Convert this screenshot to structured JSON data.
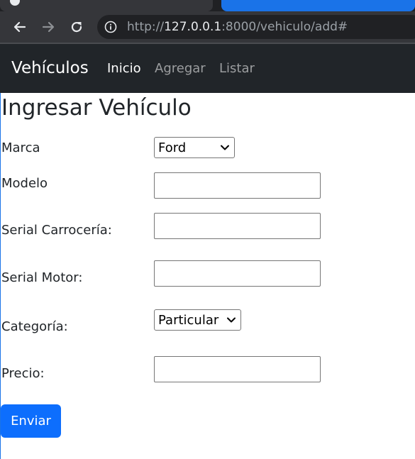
{
  "browser": {
    "url_scheme": "http://",
    "url_host": "127.0.0.1",
    "url_rest": ":8000/vehiculo/add#",
    "colors": {
      "frame": "#202124",
      "toolbar": "#35363a",
      "tab_accent": "#1a73e8"
    },
    "icons": [
      "back-arrow-icon",
      "forward-arrow-icon",
      "reload-icon",
      "info-icon"
    ]
  },
  "navbar": {
    "brand": "Vehículos",
    "links": [
      {
        "label": "Inicio",
        "active": true
      },
      {
        "label": "Agregar",
        "active": false
      },
      {
        "label": "Listar",
        "active": false
      }
    ],
    "color": "#212529"
  },
  "form": {
    "title": "Ingresar Vehículo",
    "fields": {
      "marca": {
        "label": "Marca",
        "selected": "Ford"
      },
      "modelo": {
        "label": "Modelo",
        "value": ""
      },
      "serial_carroceria": {
        "label": "Serial Carrocería:",
        "value": ""
      },
      "serial_motor": {
        "label": "Serial Motor:",
        "value": ""
      },
      "categoria": {
        "label": "Categoría:",
        "selected": "Particular"
      },
      "precio": {
        "label": "Precio:",
        "value": ""
      }
    },
    "submit_label": "Enviar",
    "accent": "#0d6efd"
  }
}
